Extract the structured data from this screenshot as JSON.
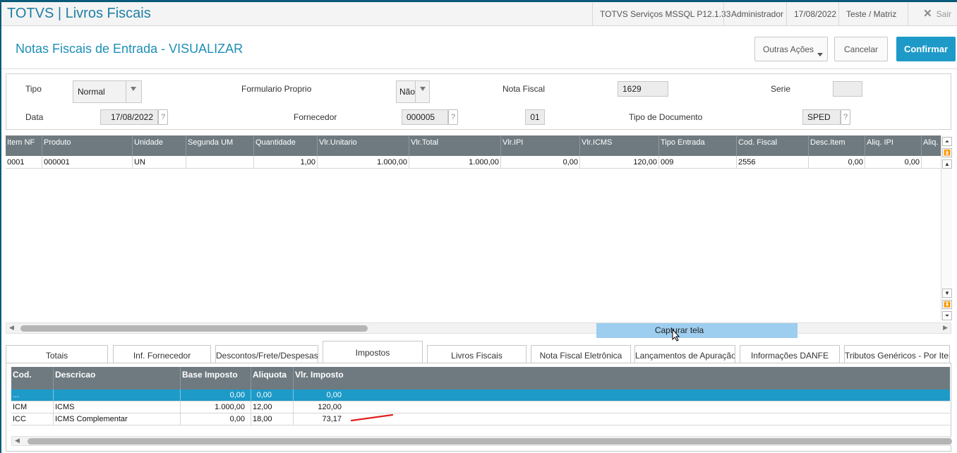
{
  "topbar": {
    "app_title": "TOTVS | Livros Fiscais",
    "server": "TOTVS Serviços MSSQL P12.1.33",
    "user": "Administrador",
    "date": "17/08/2022",
    "branch": "Teste / Matriz",
    "exit_label": "Sair"
  },
  "header": {
    "title": "Notas Fiscais de Entrada - VISUALIZAR",
    "other_actions": "Outras Ações",
    "cancel": "Cancelar",
    "confirm": "Confirmar"
  },
  "form": {
    "tipo_label": "Tipo",
    "tipo_value": "Normal",
    "formulario_label": "Formulario Proprio",
    "formulario_value": "Não",
    "nota_label": "Nota Fiscal",
    "nota_value": "1629",
    "serie_label": "Serie",
    "serie_value": "",
    "data_label": "Data",
    "data_value": "17/08/2022",
    "fornecedor_label": "Fornecedor",
    "fornecedor_value": "000005",
    "loja_value": "01",
    "tipodoc_label": "Tipo de Documento",
    "tipodoc_value": "SPED",
    "help": "?"
  },
  "items_grid": {
    "columns": [
      "Item NF",
      "Produto",
      "Unidade",
      "Segunda UM",
      "Quantidade",
      "Vlr.Unitario",
      "Vlr.Total",
      "Vlr.IPI",
      "Vlr.ICMS",
      "Tipo Entrada",
      "Cod. Fiscal",
      "Desc.Item",
      "Aliq. IPI",
      "Aliq."
    ],
    "rows": [
      [
        "0001",
        "000001",
        "UN",
        "",
        "1,00",
        "1.000,00",
        "1.000,00",
        "0,00",
        "120,00",
        "009",
        "2556",
        "0,00",
        "0,00",
        ""
      ]
    ]
  },
  "capture_label": "Capturar tela",
  "tabs": [
    "Totais",
    "Inf. Fornecedor",
    "Descontos/Frete/Despesas",
    "Impostos",
    "Livros Fiscais",
    "Nota Fiscal Eletrônica",
    "Lançamentos de Apuração",
    "Informações DANFE",
    "Tributos Genéricos - Por Item"
  ],
  "active_tab": "Impostos",
  "tax_grid": {
    "columns": [
      "Cod.",
      "Descricao",
      "Base Imposto",
      "Aliquota",
      "Vlr. Imposto"
    ],
    "rows": [
      [
        "...",
        "",
        "0,00",
        "0,00",
        "0,00"
      ],
      [
        "ICM",
        "ICMS",
        "1.000,00",
        "12,00",
        "120,00"
      ],
      [
        "ICC",
        "ICMS Complementar",
        "0,00",
        "18,00",
        "73,17"
      ]
    ]
  },
  "colors": {
    "accent": "#1e9ac8",
    "grid_header": "#6e7a80",
    "capture_bg": "#9dcdef",
    "annotation": "#e02020"
  },
  "icons": [
    "close-icon",
    "dropdown-caret-icon",
    "help-icon",
    "scroll-top-icon",
    "scroll-up-icon",
    "scroll-down-icon",
    "scroll-bottom-icon",
    "mouse-cursor-icon"
  ]
}
